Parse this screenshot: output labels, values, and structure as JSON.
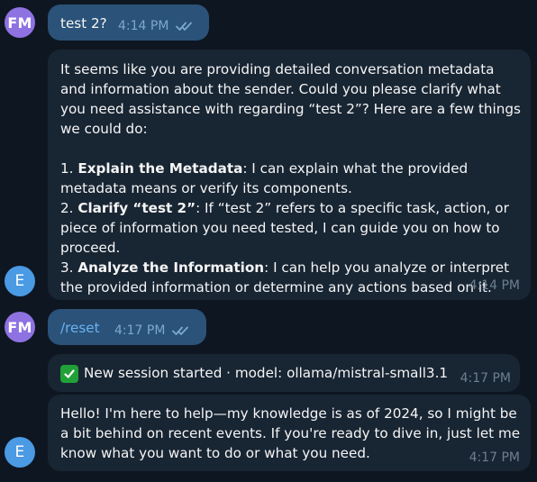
{
  "messages": [
    {
      "sender_initials": "FM",
      "text": "test 2?",
      "time": "4:14 PM"
    },
    {
      "sender_initials": "E",
      "intro": "It seems like you are providing detailed conversation metadata and information about the sender. Could you please clarify what you need assistance with regarding “test 2”? Here are a few things we could do:",
      "items": [
        {
          "num": "1. ",
          "title": "Explain the Metadata",
          "rest": ": I can explain what the provided metadata means or verify its components."
        },
        {
          "num": "2. ",
          "title": "Clarify “test 2”",
          "rest": ": If “test 2” refers to a specific task, action, or piece of information you need tested, I can guide you on how to proceed."
        },
        {
          "num": "3. ",
          "title": "Analyze the Information",
          "rest": ": I can help you analyze or interpret the provided information or determine any actions based on it."
        }
      ],
      "time": "4:14 PM"
    },
    {
      "sender_initials": "FM",
      "text": "/reset",
      "time": "4:17 PM"
    },
    {
      "text": "New session started · model: ollama/mistral-small3.1",
      "time": "4:17 PM"
    },
    {
      "sender_initials": "E",
      "text": "Hello! I'm here to help—my knowledge is as of 2024, so I might be a bit behind on recent events. If you're ready to dive in, just let me know what you want to do or what you need.",
      "time": "4:17 PM"
    }
  ],
  "colors": {
    "background": "#0e1621",
    "outgoing_bubble": "#2b5278",
    "incoming_bubble": "#182533",
    "user_avatar": "#8e72e2",
    "bot_avatar": "#4a9ae4",
    "link": "#6ab2f2"
  },
  "icons": {
    "read_status": "double-check-icon",
    "session_emoji": "white-check-mark-emoji"
  }
}
